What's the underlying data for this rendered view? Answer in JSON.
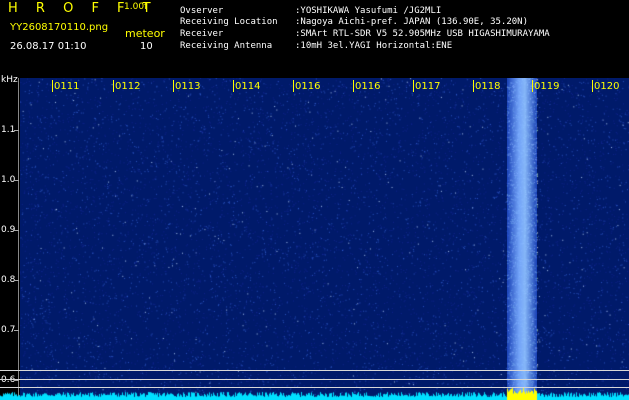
{
  "header": {
    "brand": "H R O F F T",
    "version": "1.00f",
    "filename": "YY2608170110.png",
    "mode": "meteor",
    "timestamp": "26.08.17 01:10",
    "count": "10"
  },
  "station": {
    "observer_label": "Ovserver",
    "observer_value": ":YOSHIKAWA Yasufumi /JG2MLI",
    "location_label": "Receiving Location",
    "location_value": ":Nagoya Aichi-pref. JAPAN (136.90E, 35.20N)",
    "receiver_label": "Receiver",
    "receiver_value": ":SMArt RTL-SDR V5 52.905MHz USB HIGASHIMURAYAMA",
    "antenna_label": "Receiving Antenna",
    "antenna_value": ":10mH 3el.YAGI Horizontal:ENE"
  },
  "axis": {
    "unit": "kHz",
    "y_ticks": [
      "1.1",
      "1.0",
      "0.9",
      "0.8",
      "0.7",
      "0.6"
    ],
    "time_ticks": [
      "0111",
      "0112",
      "0113",
      "0114",
      "0116",
      "0116",
      "0117",
      "0118",
      "0119",
      "0120"
    ]
  },
  "colors": {
    "background": "#000000",
    "waterfall": "#001a6a",
    "label_yellow": "#ffff00",
    "spectrum_cyan": "#00e0ff"
  }
}
